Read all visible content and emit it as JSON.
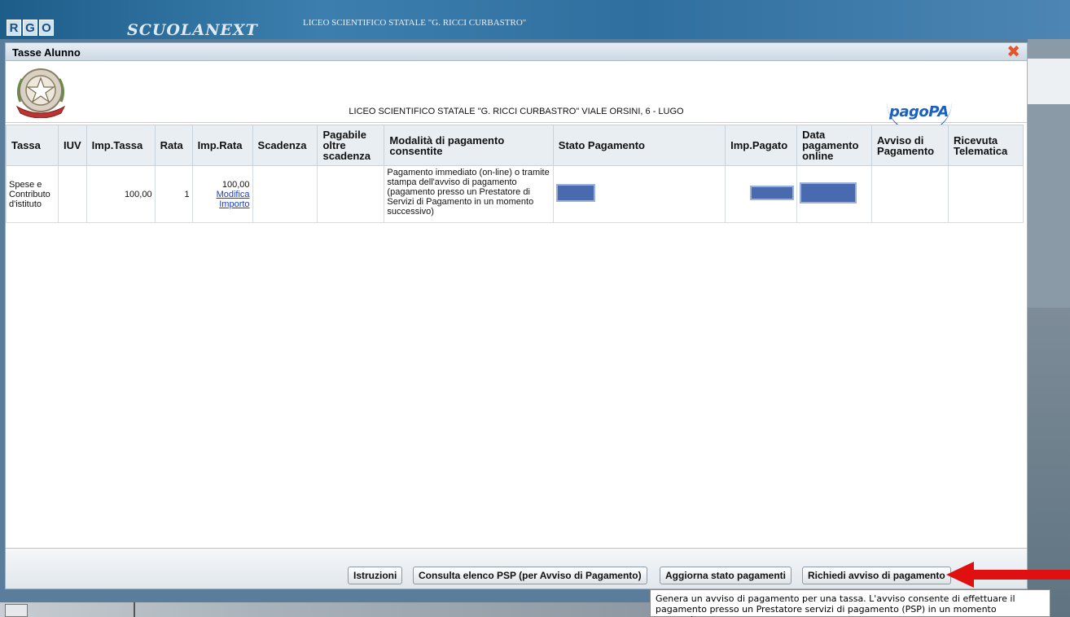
{
  "app": {
    "logo_letters": [
      "R",
      "G",
      "O"
    ],
    "brand": "SCUOLANEXT",
    "school_name": "LICEO SCIENTIFICO STATALE \"G. RICCI CURBASTRO\""
  },
  "dialog": {
    "title": "Tasse Alunno",
    "close": "✖",
    "header_text": "LICEO SCIENTIFICO STATALE \"G. RICCI CURBASTRO\" VIALE ORSINI, 6 - LUGO",
    "pagopa": "pagoPA"
  },
  "table": {
    "headers": {
      "tassa": "Tassa",
      "iuv": "IUV",
      "imp_tassa": "Imp.Tassa",
      "rata": "Rata",
      "imp_rata": "Imp.Rata",
      "scadenza": "Scadenza",
      "pagabile": "Pagabile oltre scadenza",
      "modalita": "Modalità di pagamento consentite",
      "stato": "Stato Pagamento",
      "imp_pagato": "Imp.Pagato",
      "data_pagamento": "Data pagamento online",
      "avviso": "Avviso di Pagamento",
      "ricevuta": "Ricevuta Telematica"
    },
    "row": {
      "tassa": "Spese e Contributo d'istituto",
      "iuv": "",
      "imp_tassa": "100,00",
      "rata": "1",
      "imp_rata": "100,00",
      "modifica": "Modifica Importo",
      "scadenza": "",
      "pagabile": "",
      "modalita": "Pagamento immediato (on-line) o tramite stampa dell'avviso di pagamento (pagamento presso un Prestatore di Servizi di Pagamento in un momento successivo)"
    }
  },
  "footer": {
    "istruzioni": "Istruzioni",
    "consulta": "Consulta elenco PSP (per Avviso di Pagamento)",
    "aggiorna": "Aggiorna stato pagamenti",
    "richiedi": "Richiedi avviso di pagamento"
  },
  "tooltip": {
    "text": "Genera un avviso di pagamento per una tassa. L'avviso consente di effettuare il pagamento presso un Prestatore servizi di pagamento (PSP) in un momento successivo"
  },
  "colors": {
    "arrow": "#e01010",
    "close": "#e6552a",
    "link": "#1b3fb8",
    "redaction": "#4a6ab0"
  }
}
